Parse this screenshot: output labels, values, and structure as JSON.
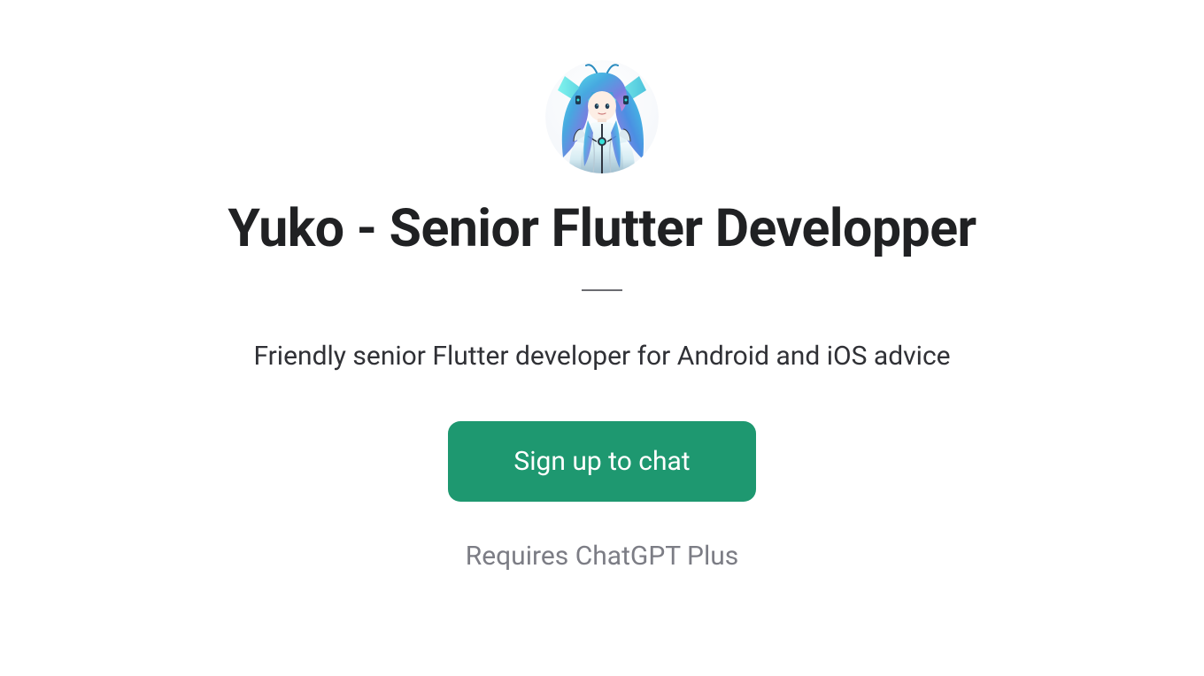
{
  "page": {
    "title": "Yuko - Senior Flutter Developper",
    "subtitle": "Friendly senior Flutter developer for Android and iOS advice",
    "cta_label": "Sign up to chat",
    "footnote": "Requires ChatGPT Plus"
  },
  "colors": {
    "accent": "#1e9870",
    "text_primary": "#202123",
    "text_body": "#303136",
    "text_muted": "#7c7d85"
  },
  "avatar": {
    "name": "anime-cyborg-girl-avatar"
  }
}
